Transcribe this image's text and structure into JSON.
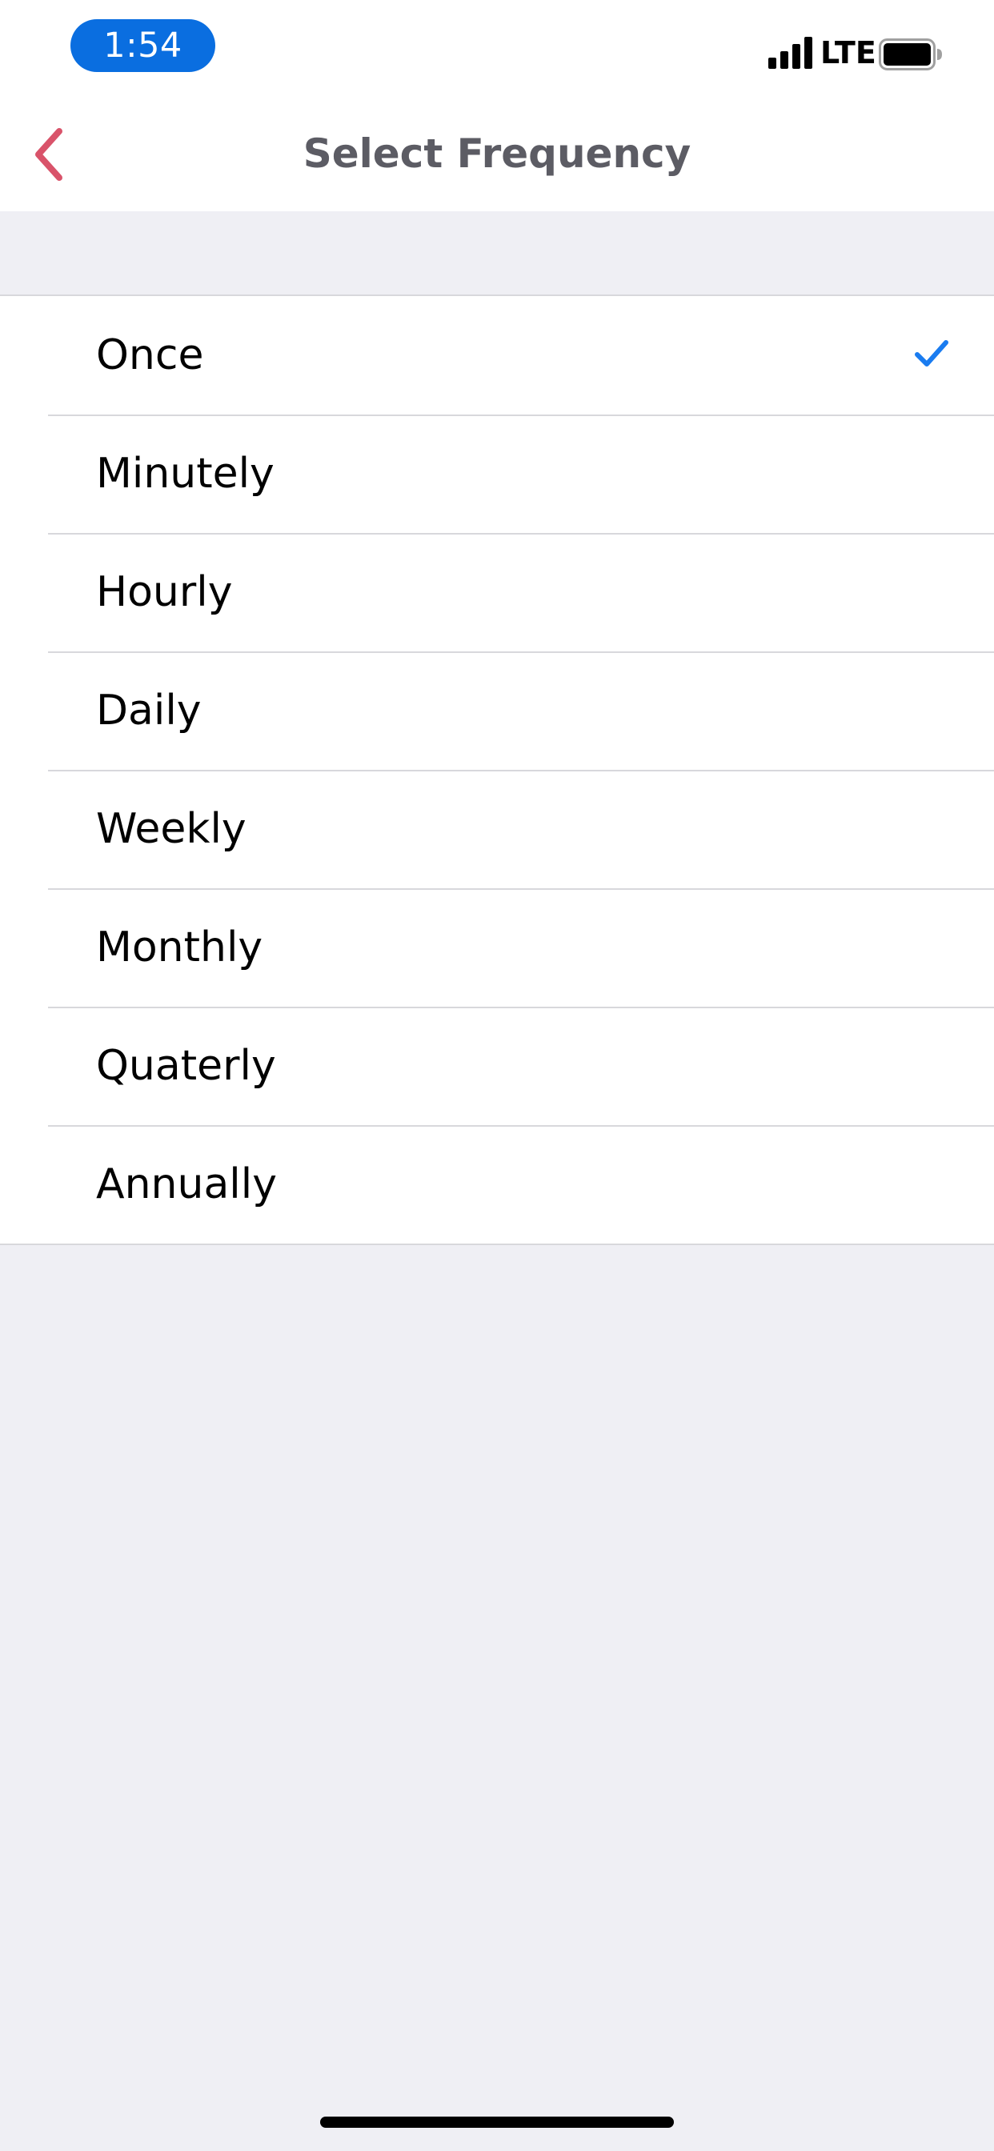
{
  "status_bar": {
    "time": "1:54",
    "network": "LTE",
    "time_pill_color": "#0a6ee0"
  },
  "nav": {
    "title": "Select Frequency",
    "back_icon": "chevron-left-icon",
    "accent_color": "#d9536a"
  },
  "frequency_list": {
    "selected": "Once",
    "check_color": "#1a7cf0",
    "items": [
      {
        "label": "Once",
        "checked": true
      },
      {
        "label": "Minutely",
        "checked": false
      },
      {
        "label": "Hourly",
        "checked": false
      },
      {
        "label": "Daily",
        "checked": false
      },
      {
        "label": "Weekly",
        "checked": false
      },
      {
        "label": "Monthly",
        "checked": false
      },
      {
        "label": "Quaterly",
        "checked": false
      },
      {
        "label": "Annually",
        "checked": false
      }
    ]
  }
}
